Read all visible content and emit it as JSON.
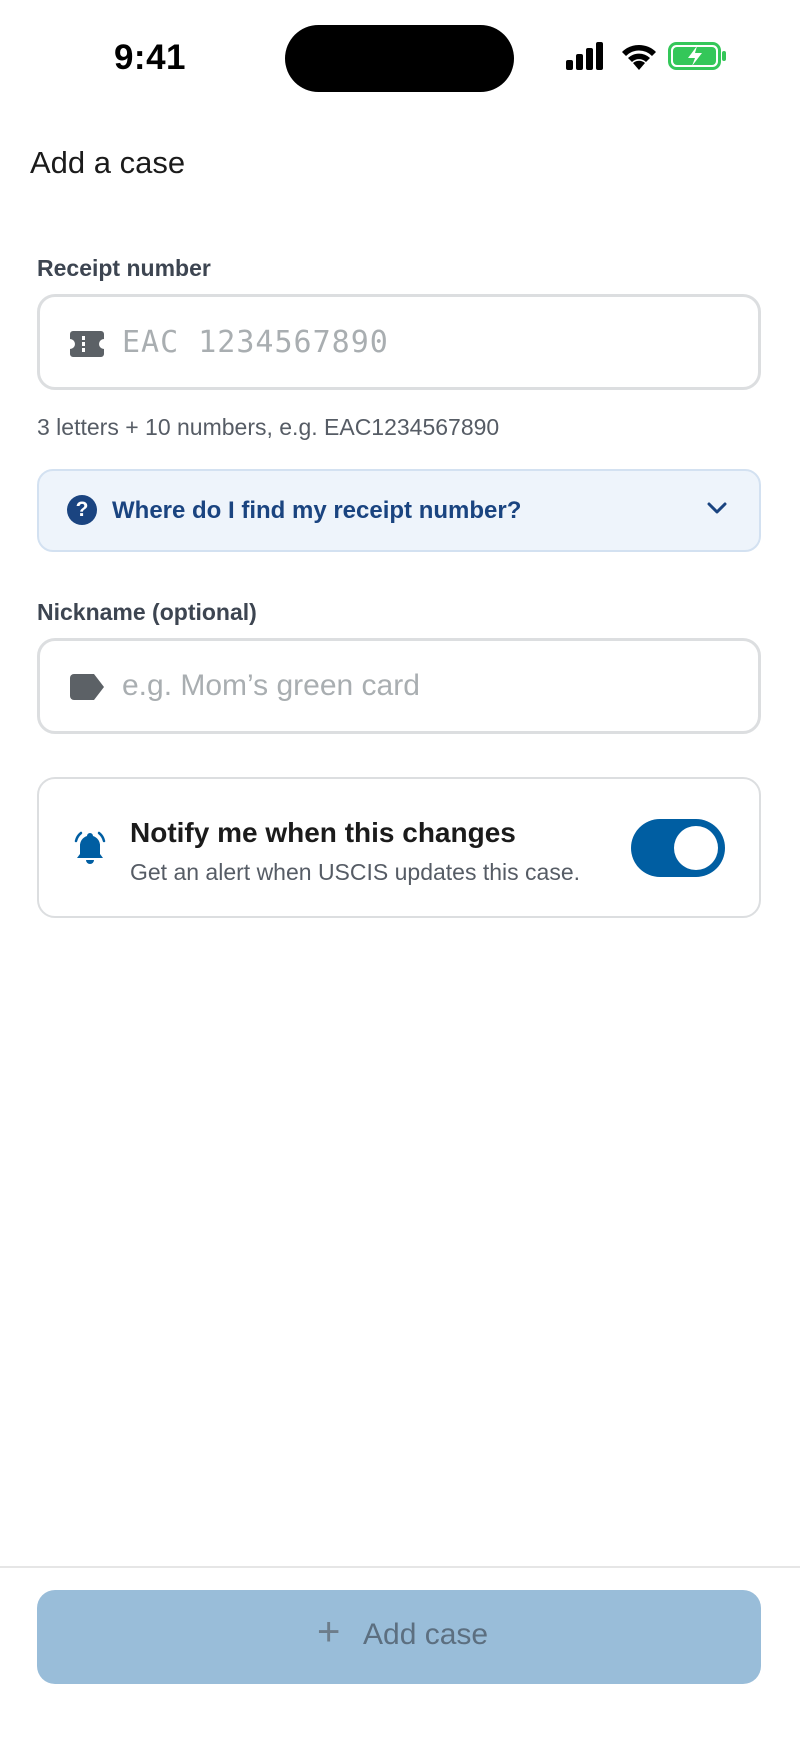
{
  "status_bar": {
    "time": "9:41",
    "icons": [
      "signal-icon",
      "wifi-icon",
      "battery-charging-icon"
    ],
    "battery_color": "#34c759"
  },
  "page": {
    "title": "Add a case"
  },
  "receipt": {
    "label": "Receipt number",
    "value": "",
    "placeholder": "EAC 1234567890",
    "icon": "ticket-icon",
    "hint": "3 letters + 10 numbers, e.g. EAC1234567890"
  },
  "help_accordion": {
    "label": "Where do I find my receipt number?",
    "icon": "question-circle-icon",
    "expanded": false
  },
  "nickname": {
    "label": "Nickname (optional)",
    "value": "",
    "placeholder": "e.g. Mom’s green card",
    "icon": "tag-icon"
  },
  "notify": {
    "title": "Notify me when this changes",
    "subtitle": "Get an alert when USCIS updates this case.",
    "icon": "bell-ringing-icon",
    "enabled": true
  },
  "footer": {
    "add_button_label": "Add case",
    "add_button_icon": "plus-icon",
    "add_button_disabled": true
  },
  "colors": {
    "primary": "#005ea2",
    "primary_dark": "#1a4480",
    "button_disabled": "#99bdd9",
    "accordion_bg": "#eef4fb"
  }
}
